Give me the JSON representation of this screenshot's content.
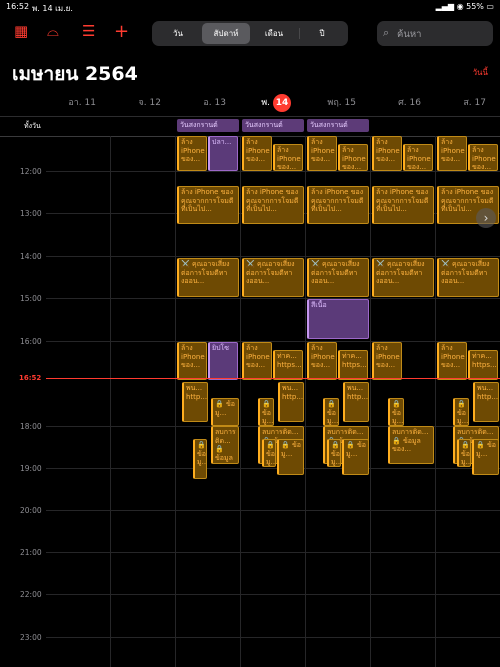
{
  "status": {
    "time": "16:52",
    "date": "พ. 14 เม.ย.",
    "battery": "55%"
  },
  "toolbar": {
    "calendar_icon": "calendar-icon",
    "inbox_icon": "inbox-icon",
    "list_icon": "list-icon",
    "add_icon": "plus-icon",
    "views": [
      "วัน",
      "สัปดาห์",
      "เดือน",
      "ปี"
    ],
    "selected_view": "สัปดาห์",
    "search_placeholder": "ค้นหา"
  },
  "header": {
    "month": "เมษายน 2564",
    "today": "วันนี้"
  },
  "days": [
    {
      "name": "อา.",
      "num": "11"
    },
    {
      "name": "จ.",
      "num": "12"
    },
    {
      "name": "อ.",
      "num": "13"
    },
    {
      "name": "พ.",
      "num": "14"
    },
    {
      "name": "พฤ.",
      "num": "15"
    },
    {
      "name": "ศ.",
      "num": "16"
    },
    {
      "name": "ส.",
      "num": "17"
    }
  ],
  "allday": {
    "label": "ทั้งวัน",
    "events": [
      "วันสงกรานต์",
      "วันสงกรานต์",
      "วันสงกรานต์"
    ]
  },
  "hours": [
    "12:00",
    "13:00",
    "14:00",
    "15:00",
    "16:00",
    "18:00",
    "19:00",
    "20:00",
    "21:00",
    "22:00",
    "23:00"
  ],
  "now_label": "16:52",
  "events": {
    "wash_short": "ล้าง iPhone ของ...",
    "wash_long": "ล้าง iPhone ของคุณจากการโจมตีที่เป็นไป...",
    "threat": "⚔️ คุณอาจเสี่ยงต่อการโจมตีทางออน...",
    "misc": "ปลา...",
    "note": "สีเนื้อ",
    "symbol": "ยิปโซ",
    "https": "ท่าค... https...",
    "pn": "พน... http...",
    "info": "🔒 ข้อมู...",
    "delete": "ลบการติด... 🔒 ข้อมูลของ..."
  }
}
